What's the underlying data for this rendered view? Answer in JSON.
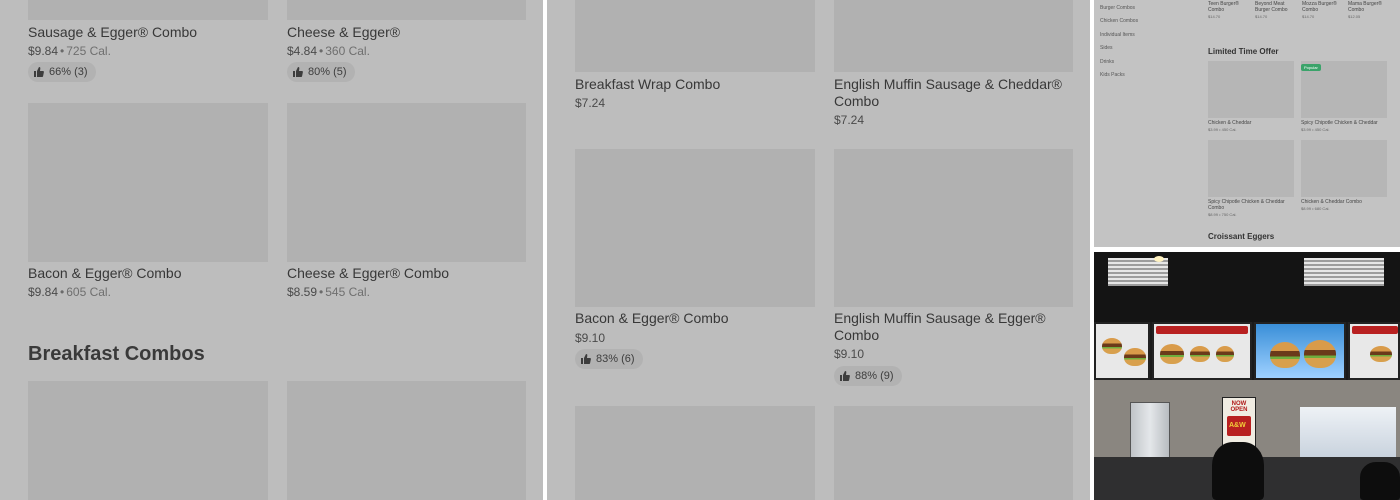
{
  "left_panel": {
    "items": [
      {
        "name": "Sausage & Egger® Combo",
        "price": "$9.84",
        "calories": "725 Cal.",
        "rating": "66% (3)"
      },
      {
        "name": "Cheese & Egger®",
        "price": "$4.84",
        "calories": "360 Cal.",
        "rating": "80% (5)"
      },
      {
        "name": "Bacon & Egger® Combo",
        "price": "$9.84",
        "calories": "605 Cal."
      },
      {
        "name": "Cheese & Egger® Combo",
        "price": "$8.59",
        "calories": "545 Cal."
      }
    ],
    "section_title": "Breakfast Combos"
  },
  "middle_panel": {
    "items": [
      {
        "name": "Breakfast Wrap Combo",
        "price": "$7.24"
      },
      {
        "name": "English Muffin Sausage & Cheddar® Combo",
        "price": "$7.24"
      },
      {
        "name": "Bacon & Egger® Combo",
        "price": "$9.10",
        "rating": "83% (6)"
      },
      {
        "name": "English Muffin Sausage & Egger® Combo",
        "price": "$9.10",
        "rating": "88% (9)"
      }
    ]
  },
  "mini_page": {
    "categories": [
      "Burger Combos",
      "Chicken Combos",
      "Individual Items",
      "Sides",
      "Drinks",
      "Kids Packs"
    ],
    "top_items": [
      {
        "name": "Teen Burger® Combo",
        "price": "$14.70"
      },
      {
        "name": "Beyond Meat Burger Combo",
        "price": "$14.70"
      },
      {
        "name": "Mozza Burger® Combo",
        "price": "$14.70"
      },
      {
        "name": "Mama Burger® Combo",
        "price": "$12.05"
      }
    ],
    "limited_title": "Limited Time Offer",
    "popular_badge": "Popular",
    "limited_items": [
      {
        "name": "Chicken & Cheddar",
        "price": "$3.99",
        "calories": "450 Cal."
      },
      {
        "name": "Spicy Chipotle Chicken & Cheddar",
        "price": "$3.99",
        "calories": "450 Cal."
      },
      {
        "name": "Spicy Chipotle Chicken & Cheddar Combo",
        "price": "$8.99",
        "calories": "750 Cal."
      },
      {
        "name": "Chicken & Cheddar Combo",
        "price": "$8.99",
        "calories": "680 Cal."
      }
    ],
    "next_section": "Croissant Eggers"
  },
  "photo": {
    "poster_text": "NOW OPEN",
    "board_text": "A&W"
  }
}
